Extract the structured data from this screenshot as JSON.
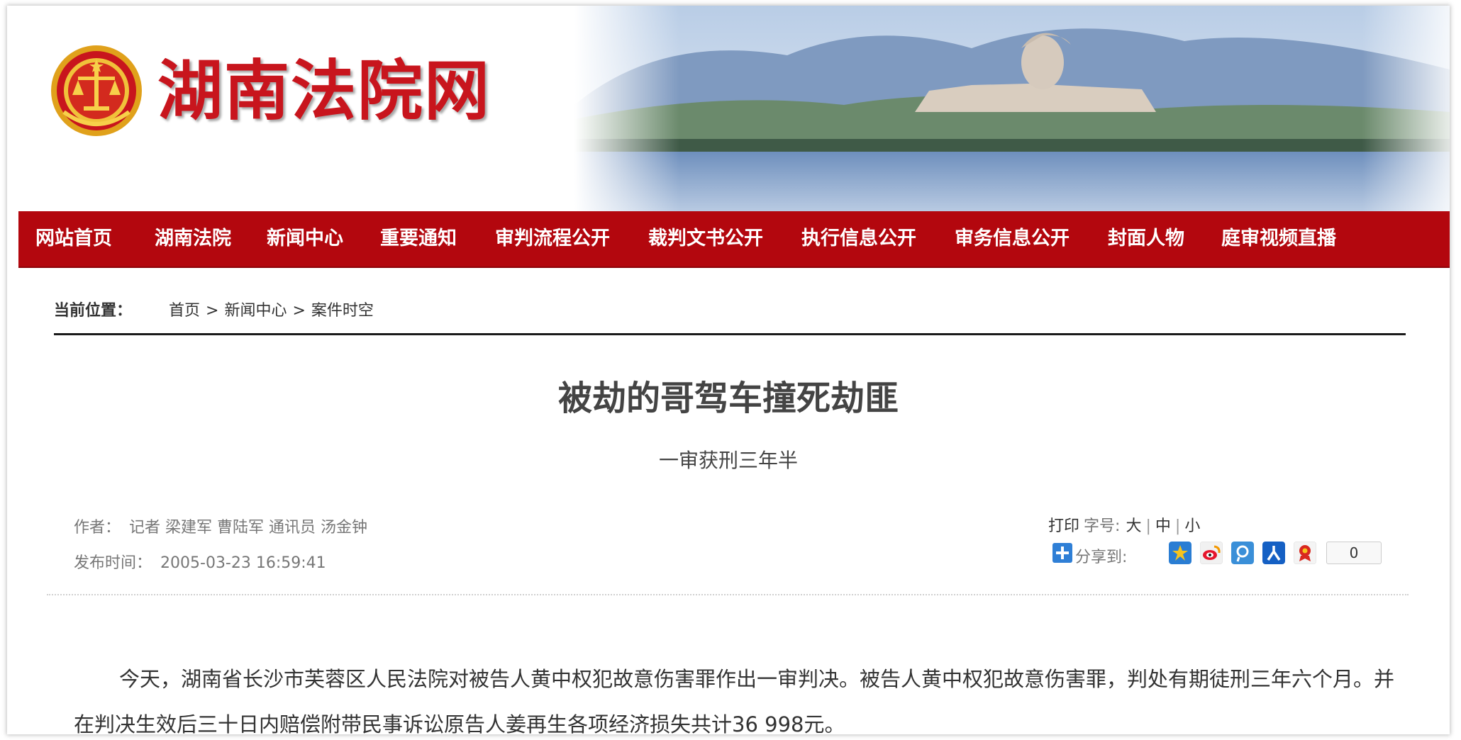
{
  "site": {
    "title": "湖南法院网"
  },
  "nav": {
    "items": [
      {
        "label": "网站首页"
      },
      {
        "label": "湖南法院"
      },
      {
        "label": "新闻中心"
      },
      {
        "label": "重要通知"
      },
      {
        "label": "审判流程公开"
      },
      {
        "label": "裁判文书公开"
      },
      {
        "label": "执行信息公开"
      },
      {
        "label": "审务信息公开"
      },
      {
        "label": "封面人物"
      },
      {
        "label": "庭审视频直播"
      }
    ]
  },
  "breadcrumb": {
    "label": "当前位置：",
    "items": [
      {
        "label": "首页"
      },
      {
        "label": "新闻中心"
      },
      {
        "label": "案件时空"
      }
    ],
    "separator": ">"
  },
  "article": {
    "title": "被劫的哥驾车撞死劫匪",
    "subtitle": "一审获刑三年半",
    "author_label": "作者：",
    "author": "记者 梁建军 曹陆军 通讯员 汤金钟",
    "date_label": "发布时间：",
    "date": "2005-03-23 16:59:41",
    "paragraph": "今天，湖南省长沙市芙蓉区人民法院对被告人黄中权犯故意伤害罪作出一审判决。被告人黄中权犯故意伤害罪，判处有期徒刑三年六个月。并在判决生效后三十日内赔偿附带民事诉讼原告人姜再生各项经济损失共计36 998元。"
  },
  "tools": {
    "print_label": "打印",
    "font_size_label": "字号:",
    "font_sizes": [
      "大",
      "中",
      "小"
    ],
    "share_label": "分享到:",
    "share_count": "0",
    "share_icons": [
      "qzone-icon",
      "weibo-icon",
      "tencent-weibo-icon",
      "renren-icon",
      "kaixin-icon"
    ]
  },
  "colors": {
    "brand_red": "#c8151d",
    "nav_red": "#b3070e"
  }
}
